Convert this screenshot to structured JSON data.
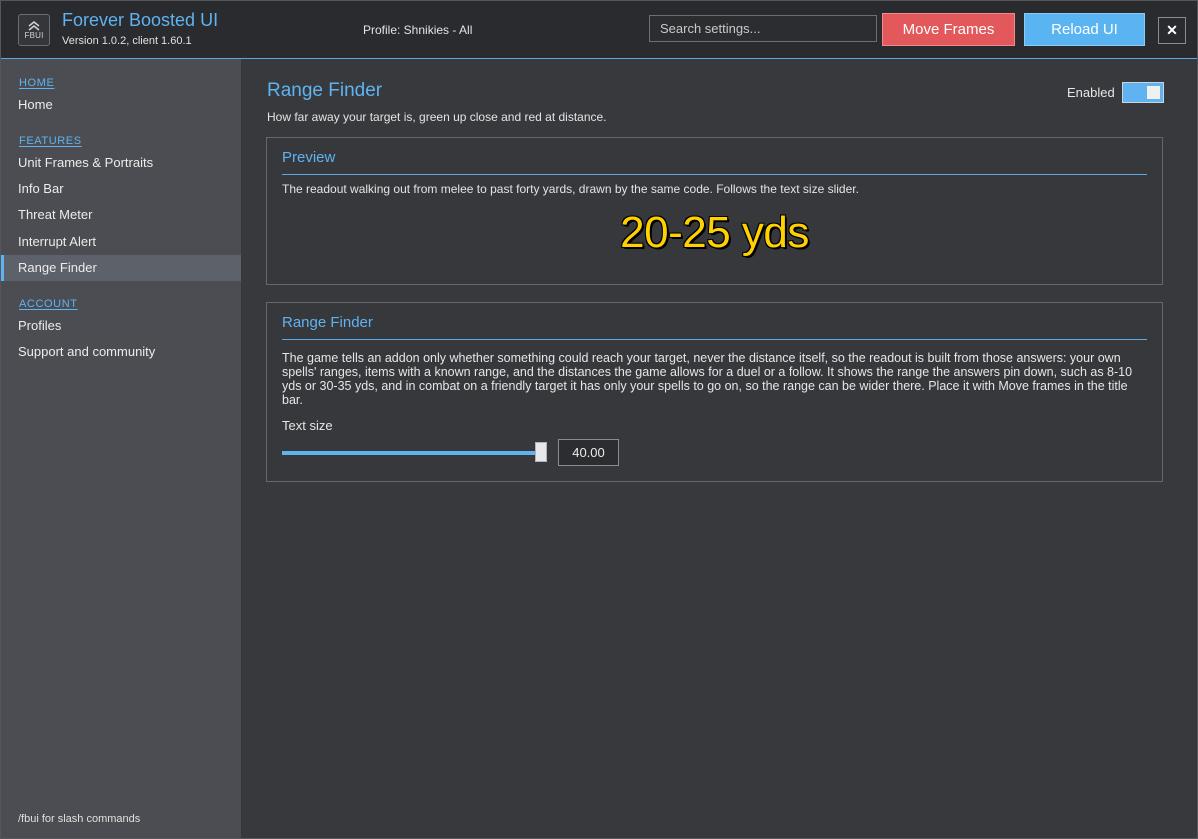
{
  "app": {
    "title": "Forever Boosted UI",
    "version": "Version 1.0.2, client 1.60.1",
    "logo_text": "FBUI",
    "profile": "Profile: Shnikies - All"
  },
  "header": {
    "search_placeholder": "Search settings...",
    "move_frames_label": "Move Frames",
    "reload_ui_label": "Reload UI",
    "close_label": "✕"
  },
  "sidebar": {
    "sections": [
      {
        "label": "HOME",
        "items": [
          {
            "label": "Home",
            "active": false
          }
        ]
      },
      {
        "label": "FEATURES",
        "items": [
          {
            "label": "Unit Frames & Portraits",
            "active": false
          },
          {
            "label": "Info Bar",
            "active": false
          },
          {
            "label": "Threat Meter",
            "active": false
          },
          {
            "label": "Interrupt Alert",
            "active": false
          },
          {
            "label": "Range Finder",
            "active": true
          }
        ]
      },
      {
        "label": "ACCOUNT",
        "items": [
          {
            "label": "Profiles",
            "active": false
          },
          {
            "label": "Support and community",
            "active": false
          }
        ]
      }
    ],
    "footer": "/fbui for slash commands"
  },
  "main": {
    "title": "Range Finder",
    "description": "How far away your target is, green up close and red at distance.",
    "enabled_label": "Enabled",
    "enabled": true,
    "preview": {
      "title": "Preview",
      "text": "The readout walking out from melee to past forty yards, drawn by the same code.  Follows the text size slider.",
      "readout": "20-25 yds"
    },
    "range_finder": {
      "title": "Range Finder",
      "body": "The game tells an addon only whether something could reach your target, never the distance itself, so the readout is built from those answers: your own spells' ranges, items with a known range, and the distances the game allows for a duel or a follow.  It shows the range the answers pin down, such as 8-10 yds or 30-35 yds, and in combat on a friendly target it has only your spells to go on, so the range can be wider there.  Place it with Move frames in the title bar.",
      "slider_label": "Text size",
      "slider_value": "40.00",
      "slider_fraction": 0.98
    }
  },
  "colors": {
    "accent": "#5eb3f0",
    "move_frames": "#e3585b",
    "reload_ui": "#5ab4f2",
    "readout": "#ffd100"
  }
}
